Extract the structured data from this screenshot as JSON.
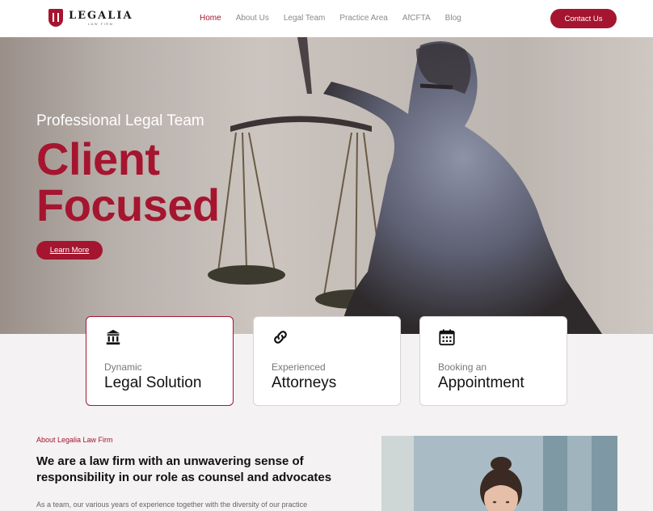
{
  "brand": {
    "name": "LEGALIA",
    "tagline": "LAW FIRM",
    "color": "#a5152f"
  },
  "nav": {
    "items": [
      {
        "label": "Home",
        "active": true
      },
      {
        "label": "About Us",
        "active": false
      },
      {
        "label": "Legal Team",
        "active": false
      },
      {
        "label": "Practice Area",
        "active": false
      },
      {
        "label": "AfCFTA",
        "active": false
      },
      {
        "label": "Blog",
        "active": false
      }
    ],
    "cta": "Contact Us"
  },
  "hero": {
    "subtitle": "Professional Legal Team",
    "title_line1": "Client",
    "title_line2": "Focused",
    "button": "Learn More"
  },
  "features": [
    {
      "icon": "bank-icon",
      "kicker": "Dynamic",
      "heading": "Legal Solution",
      "active": true
    },
    {
      "icon": "link-icon",
      "kicker": "Experienced",
      "heading": "Attorneys",
      "active": false
    },
    {
      "icon": "calendar-icon",
      "kicker": "Booking an",
      "heading": "Appointment",
      "active": false
    }
  ],
  "about": {
    "label": "About Legalia Law Firm",
    "title": "We are a law firm with an unwavering sense of responsibility in our role as counsel and advocates",
    "body": "As a team, our various years of experience together with the diversity of our practice"
  }
}
